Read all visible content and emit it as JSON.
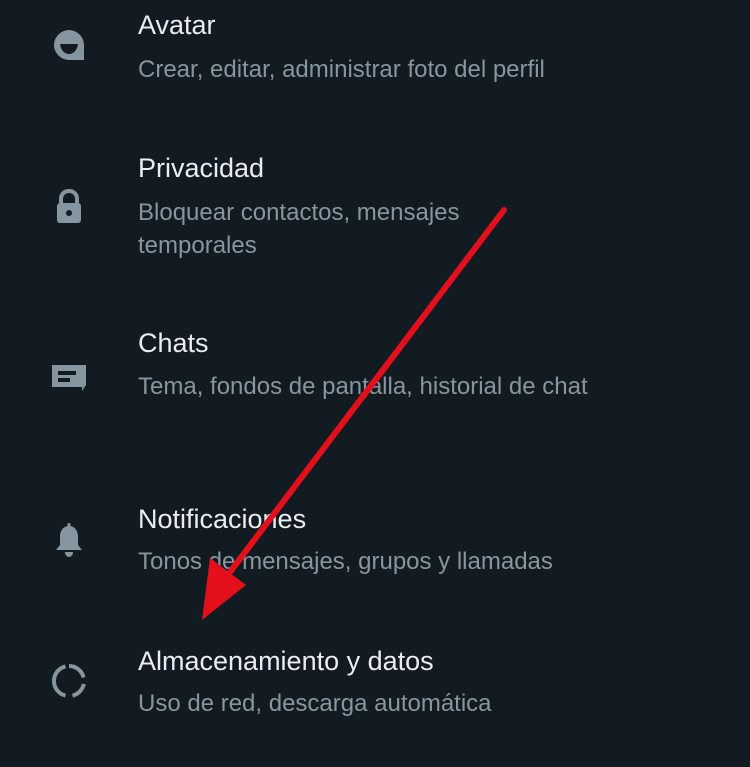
{
  "settings": {
    "items": [
      {
        "title": "Avatar",
        "subtitle": "Crear, editar, administrar foto del perfil",
        "icon": "avatar-face-icon"
      },
      {
        "title": "Privacidad",
        "subtitle": "Bloquear contactos, mensajes temporales",
        "icon": "lock-icon"
      },
      {
        "title": "Chats",
        "subtitle": "Tema, fondos de pantalla, historial de chat",
        "icon": "chat-icon"
      },
      {
        "title": "Notificaciones",
        "subtitle": "Tonos de mensajes, grupos y llamadas",
        "icon": "bell-icon"
      },
      {
        "title": "Almacenamiento y datos",
        "subtitle": "Uso de red, descarga automática",
        "icon": "data-usage-ring-icon"
      }
    ]
  },
  "colors": {
    "background": "#121b22",
    "title": "#e9edef",
    "subtitle": "#8696a0",
    "icon": "#8696a0",
    "annotation_arrow": "#e3101c"
  }
}
